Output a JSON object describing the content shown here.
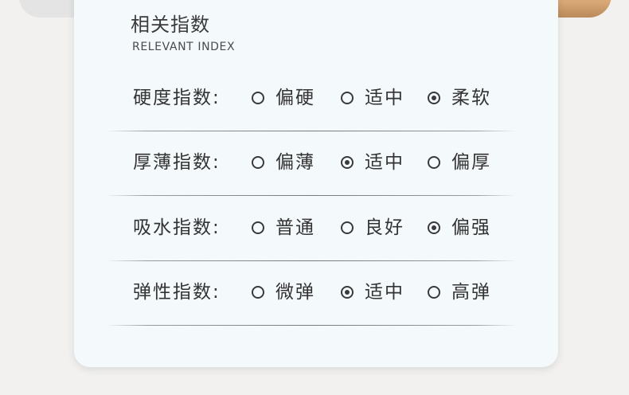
{
  "section": {
    "title": "相关指数",
    "subtitle": "RELEVANT INDEX"
  },
  "rows": [
    {
      "label": "硬度指数:",
      "options": [
        "偏硬",
        "适中",
        "柔软"
      ],
      "selected": 2
    },
    {
      "label": "厚薄指数:",
      "options": [
        "偏薄",
        "适中",
        "偏厚"
      ],
      "selected": 1
    },
    {
      "label": "吸水指数:",
      "options": [
        "普通",
        "良好",
        "偏强"
      ],
      "selected": 2
    },
    {
      "label": "弹性指数:",
      "options": [
        "微弹",
        "适中",
        "高弹"
      ],
      "selected": 1
    }
  ]
}
